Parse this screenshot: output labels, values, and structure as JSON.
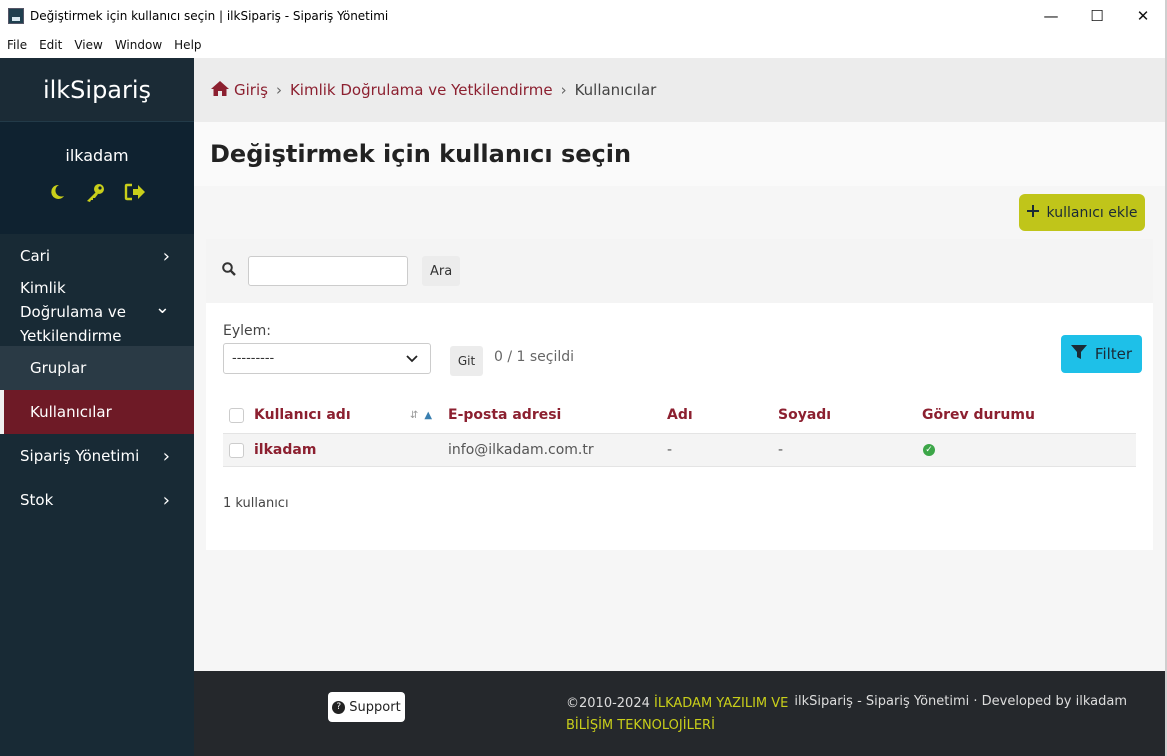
{
  "window": {
    "title": "Değiştirmek için kullanıcı seçin | ilkSipariş - Sipariş Yönetimi",
    "minimize": "—",
    "maximize": "☐",
    "close": "✕"
  },
  "menu": [
    "File",
    "Edit",
    "View",
    "Window",
    "Help"
  ],
  "sidebar": {
    "brand": "ilkSipariş",
    "username": "ilkadam",
    "icons": [
      "moon-icon",
      "key-icon",
      "logout-icon"
    ],
    "items": [
      {
        "label": "Cari",
        "chevron": "›"
      },
      {
        "label": "Kimlik Doğrulama ve Yetkilendirme",
        "chevron": "⌄"
      },
      {
        "label": "Gruplar"
      },
      {
        "label": "Kullanıcılar"
      },
      {
        "label": "Sipariş Yönetimi",
        "chevron": "›"
      },
      {
        "label": "Stok",
        "chevron": "›"
      }
    ]
  },
  "breadcrumb": {
    "home": "Giriş",
    "section": "Kimlik Doğrulama ve Yetkilendirme",
    "current": "Kullanıcılar",
    "separator": "›"
  },
  "page": {
    "title": "Değiştirmek için kullanıcı seçin",
    "add_button": "kullanıcı ekle"
  },
  "search": {
    "value": "",
    "button": "Ara"
  },
  "actions": {
    "label": "Eylem:",
    "selected_option": "---------",
    "go_button": "Git",
    "selected_count": "0 / 1 seçildi",
    "filter_button": "Filter"
  },
  "table": {
    "columns": [
      "Kullanıcı adı",
      "E-posta adresi",
      "Adı",
      "Soyadı",
      "Görev durumu"
    ],
    "rows": [
      {
        "username": "ilkadam",
        "email": "info@ilkadam.com.tr",
        "first_name": "-",
        "last_name": "-",
        "staff": true
      }
    ],
    "count_text": "1 kullanıcı"
  },
  "footer": {
    "support": "Support",
    "copyright": "©2010-2024",
    "company": "İLKADAM YAZILIM VE BİLİŞİM TEKNOLOJİLERİ",
    "credits": "ilkSipariş - Sipariş Yönetimi · Developed by ilkadam"
  },
  "colors": {
    "sidebar_bg": "#182a35",
    "active_item_bg": "#6e1a26",
    "accent_green": "#c0c51a",
    "filter_blue": "#1ec0e8",
    "link_red": "#8c2030"
  }
}
